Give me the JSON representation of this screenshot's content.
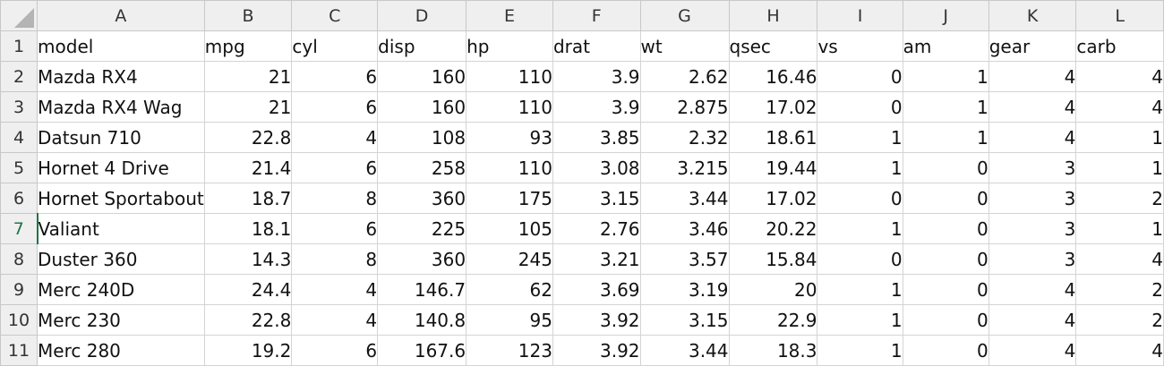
{
  "columns": [
    "A",
    "B",
    "C",
    "D",
    "E",
    "F",
    "G",
    "H",
    "I",
    "J",
    "K",
    "L"
  ],
  "rows": [
    {
      "num": "1",
      "cells": [
        "model",
        "mpg",
        "cyl",
        "disp",
        "hp",
        "drat",
        "wt",
        "qsec",
        "vs",
        "am",
        "gear",
        "carb"
      ]
    },
    {
      "num": "2",
      "cells": [
        "Mazda RX4",
        "21",
        "6",
        "160",
        "110",
        "3.9",
        "2.62",
        "16.46",
        "0",
        "1",
        "4",
        "4"
      ]
    },
    {
      "num": "3",
      "cells": [
        "Mazda RX4 Wag",
        "21",
        "6",
        "160",
        "110",
        "3.9",
        "2.875",
        "17.02",
        "0",
        "1",
        "4",
        "4"
      ]
    },
    {
      "num": "4",
      "cells": [
        "Datsun 710",
        "22.8",
        "4",
        "108",
        "93",
        "3.85",
        "2.32",
        "18.61",
        "1",
        "1",
        "4",
        "1"
      ]
    },
    {
      "num": "5",
      "cells": [
        "Hornet 4 Drive",
        "21.4",
        "6",
        "258",
        "110",
        "3.08",
        "3.215",
        "19.44",
        "1",
        "0",
        "3",
        "1"
      ]
    },
    {
      "num": "6",
      "cells": [
        "Hornet Sportabout",
        "18.7",
        "8",
        "360",
        "175",
        "3.15",
        "3.44",
        "17.02",
        "0",
        "0",
        "3",
        "2"
      ]
    },
    {
      "num": "7",
      "cells": [
        "Valiant",
        "18.1",
        "6",
        "225",
        "105",
        "2.76",
        "3.46",
        "20.22",
        "1",
        "0",
        "3",
        "1"
      ]
    },
    {
      "num": "8",
      "cells": [
        "Duster 360",
        "14.3",
        "8",
        "360",
        "245",
        "3.21",
        "3.57",
        "15.84",
        "0",
        "0",
        "3",
        "4"
      ]
    },
    {
      "num": "9",
      "cells": [
        "Merc 240D",
        "24.4",
        "4",
        "146.7",
        "62",
        "3.69",
        "3.19",
        "20",
        "1",
        "0",
        "4",
        "2"
      ]
    },
    {
      "num": "10",
      "cells": [
        "Merc 230",
        "22.8",
        "4",
        "140.8",
        "95",
        "3.92",
        "3.15",
        "22.9",
        "1",
        "0",
        "4",
        "2"
      ]
    },
    {
      "num": "11",
      "cells": [
        "Merc 280",
        "19.2",
        "6",
        "167.6",
        "123",
        "3.92",
        "3.44",
        "18.3",
        "1",
        "0",
        "4",
        "4"
      ]
    }
  ],
  "active_row": "7"
}
